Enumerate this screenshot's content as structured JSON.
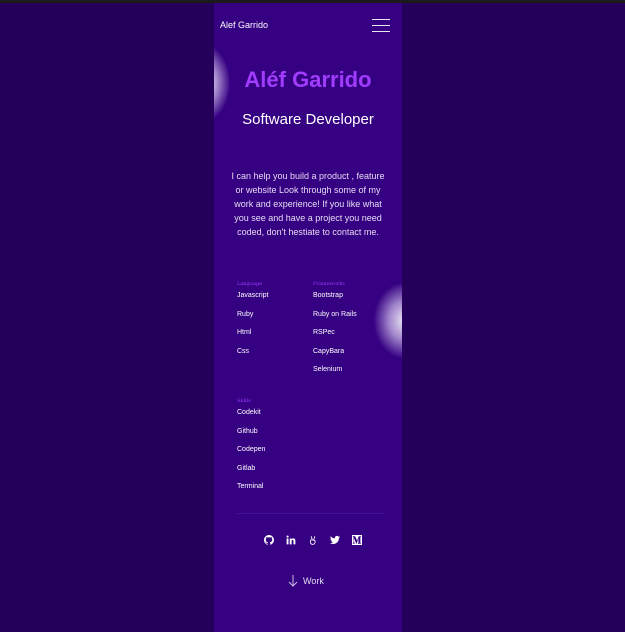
{
  "header": {
    "brand": "Alef Garrido",
    "menu_icon": "hamburger-icon"
  },
  "hero": {
    "name": "Aléf Garrido",
    "role": "Software Developer",
    "intro": "I can help you build a product , feature or website Look through some of my work and experience! If you like what you see and have a project you need coded, don't hestiate to contact me."
  },
  "skills": {
    "languages": {
      "title": "Language",
      "items": [
        "Javascript",
        "Ruby",
        "Html",
        "Css"
      ]
    },
    "frameworks": {
      "title": "Frameworks",
      "items": [
        "Bootstrap",
        "Ruby on Rails",
        "RSPec",
        "CapyBara",
        "Selenium"
      ]
    },
    "skills": {
      "title": "Skills",
      "items": [
        "Codekit",
        "Github",
        "Codepen",
        "Gitlab",
        "Terminal"
      ]
    }
  },
  "social": {
    "icons": [
      "github-icon",
      "linkedin-icon",
      "angellist-icon",
      "twitter-icon",
      "medium-icon"
    ]
  },
  "footer": {
    "work_label": "Work"
  },
  "colors": {
    "background": "#24005a",
    "panel": "#350082",
    "accent": "#a13cff",
    "text": "#ffffff"
  }
}
